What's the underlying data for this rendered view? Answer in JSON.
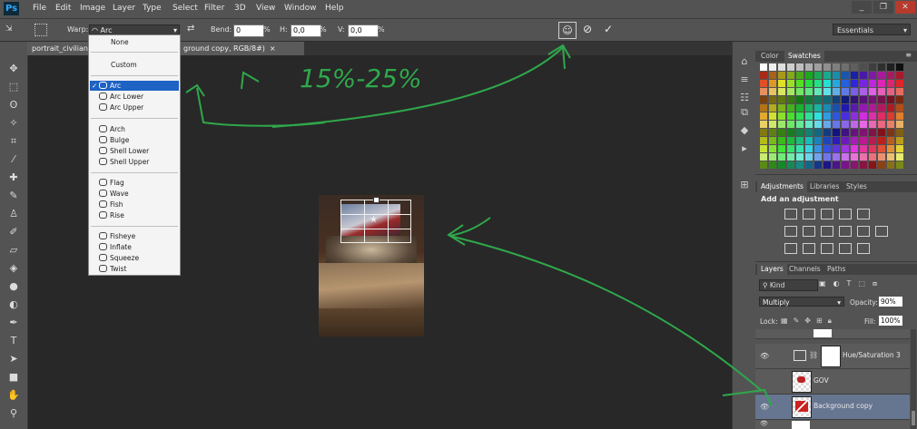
{
  "app": {
    "logo": "Ps",
    "workspace": "Essentials"
  },
  "menu": [
    "File",
    "Edit",
    "Image",
    "Layer",
    "Type",
    "Select",
    "Filter",
    "3D",
    "View",
    "Window",
    "Help"
  ],
  "window_controls": [
    "_",
    "❐",
    "✕"
  ],
  "options": {
    "warp_label": "Warp:",
    "warp_value": "Arc",
    "bend_label": "Bend:",
    "bend_value": "0",
    "h_label": "H:",
    "h_value": "0,0",
    "v_label": "V:",
    "v_value": "0,0",
    "percent": "%"
  },
  "doc_tabs": [
    {
      "title": "portrait_civilian"
    },
    {
      "title": "ground copy, RGB/8#)"
    }
  ],
  "warp_menu": [
    {
      "label": "None",
      "selected": false
    },
    {
      "label": "Custom",
      "selected": false
    },
    {
      "label": "Arc",
      "selected": true
    },
    {
      "label": "Arc Lower",
      "selected": false
    },
    {
      "label": "Arc Upper",
      "selected": false
    },
    {
      "label": "Arch",
      "selected": false
    },
    {
      "label": "Bulge",
      "selected": false
    },
    {
      "label": "Shell Lower",
      "selected": false
    },
    {
      "label": "Shell Upper",
      "selected": false
    },
    {
      "label": "Flag",
      "selected": false
    },
    {
      "label": "Wave",
      "selected": false
    },
    {
      "label": "Fish",
      "selected": false
    },
    {
      "label": "Rise",
      "selected": false
    },
    {
      "label": "Fisheye",
      "selected": false
    },
    {
      "label": "Inflate",
      "selected": false
    },
    {
      "label": "Squeeze",
      "selected": false
    },
    {
      "label": "Twist",
      "selected": false
    }
  ],
  "annotation": {
    "text": "15%-25%",
    "color": "#2fa84b"
  },
  "color_panel": {
    "tabs": [
      "Color",
      "Swatches"
    ],
    "active": "Swatches"
  },
  "adjustments_panel": {
    "tabs": [
      "Adjustments",
      "Libraries",
      "Styles"
    ],
    "active": "Adjustments",
    "heading": "Add an adjustment"
  },
  "layers_panel": {
    "tabs": [
      "Layers",
      "Channels",
      "Paths"
    ],
    "active": "Layers",
    "filter": "Kind",
    "blend_mode": "Multiply",
    "opacity_label": "Opacity:",
    "opacity": "90%",
    "lock_label": "Lock:",
    "fill_label": "Fill:",
    "fill": "100%",
    "layers": [
      {
        "name": "Hue/Saturation 3",
        "selected": false
      },
      {
        "name": "GOV",
        "selected": false
      },
      {
        "name": "Background copy",
        "selected": true
      }
    ]
  },
  "colors": {
    "selection": "#1e62c4",
    "arrow": "#2fa84b",
    "layer_selected": "#667590"
  }
}
